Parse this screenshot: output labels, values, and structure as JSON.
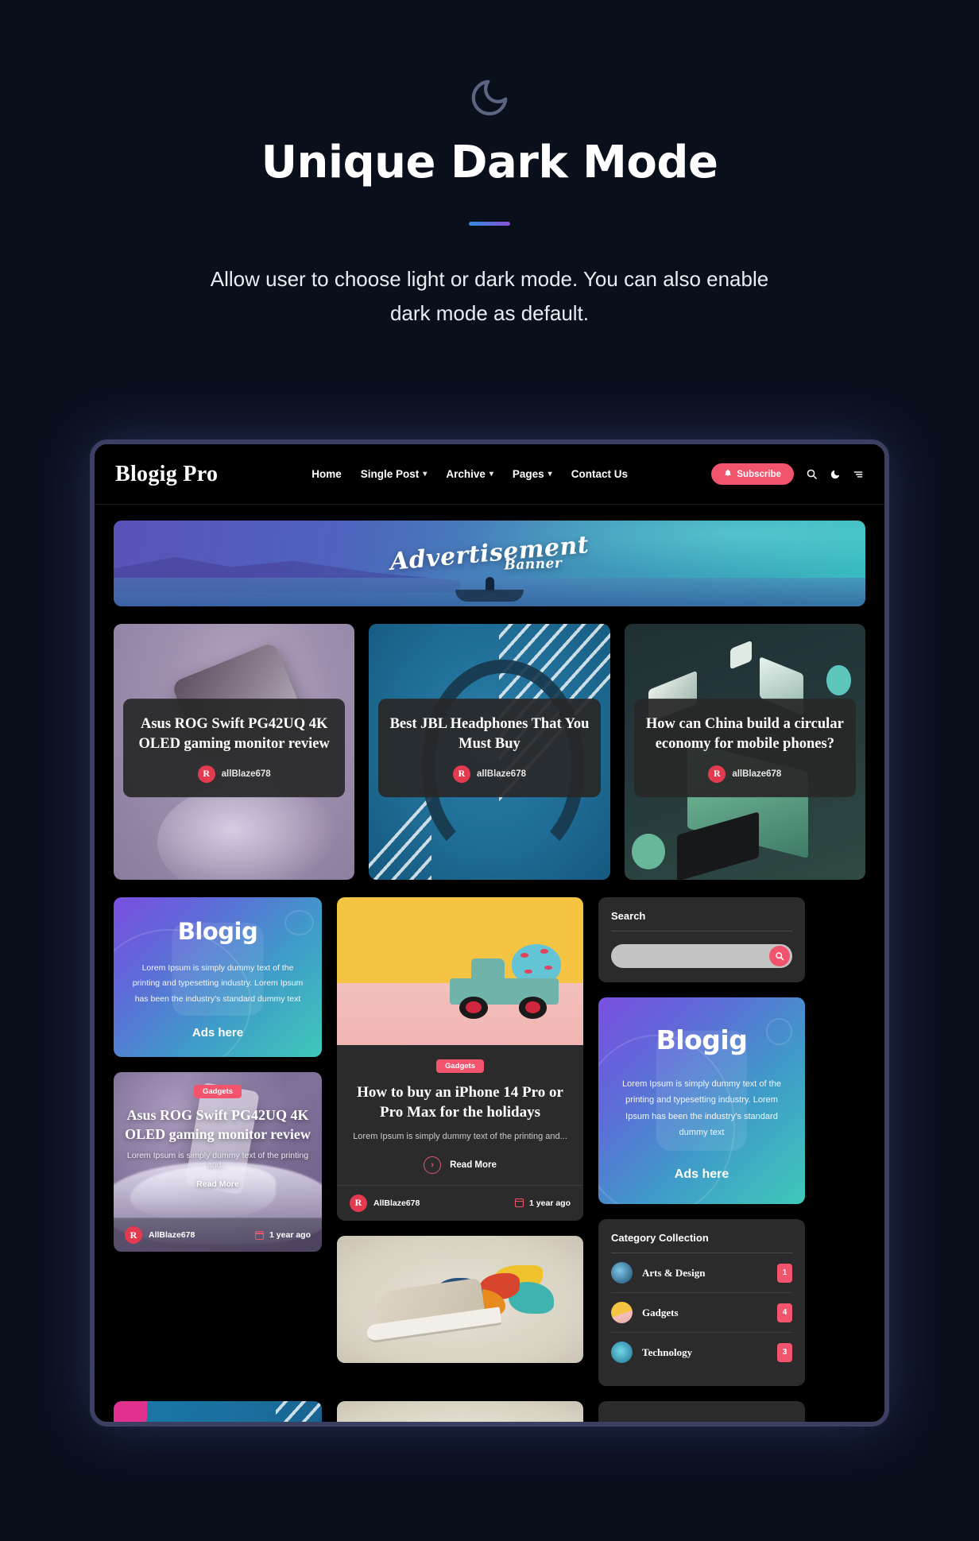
{
  "hero": {
    "icon": "moon-icon",
    "title": "Unique Dark Mode",
    "subtitle": "Allow user to choose light or dark mode. You can also enable dark mode as default.",
    "accent_start": "#2f8fe0",
    "accent_end": "#8a4fd8",
    "background": "#0a0f1c"
  },
  "site": {
    "navbar": {
      "brand": "Blogig Pro",
      "links": [
        {
          "label": "Home",
          "has_dropdown": false
        },
        {
          "label": "Single Post",
          "has_dropdown": true
        },
        {
          "label": "Archive",
          "has_dropdown": true
        },
        {
          "label": "Pages",
          "has_dropdown": true
        },
        {
          "label": "Contact Us",
          "has_dropdown": false
        }
      ],
      "chevron": "⌄",
      "subscribe_label": "Subscribe",
      "subscribe_color": "#f2536d",
      "icons": [
        "bell-icon",
        "search-icon",
        "moon-icon",
        "menu-icon"
      ]
    },
    "ad_banner": {
      "title": "Advertisement",
      "subtitle": "Banner"
    },
    "featured": [
      {
        "title": "Asus ROG Swift PG42UQ 4K OLED gaming monitor review",
        "author": "allBlaze678",
        "avatar_letter": "R",
        "image": "purple-iphone-photo"
      },
      {
        "title": "Best JBL Headphones That You Must Buy",
        "author": "allBlaze678",
        "avatar_letter": "R",
        "image": "blue-headphones-photo"
      },
      {
        "title": "How can China build a circular economy for mobile phones?",
        "author": "allBlaze678",
        "avatar_letter": "R",
        "image": "isometric-tech-illustration"
      }
    ],
    "ad_widget": {
      "brand": "Blogig",
      "text": "Lorem Ipsum is simply dummy text of the printing and typesetting industry. Lorem Ipsum has been the industry's standard dummy text",
      "cta": "Ads here"
    },
    "post_truck": {
      "badge": "Gadgets",
      "title": "How to buy an iPhone 14 Pro or Pro Max for the holidays",
      "excerpt": "Lorem Ipsum is simply dummy text of the printing and...",
      "read_more": "Read More",
      "author": "AllBlaze678",
      "avatar_letter": "R",
      "date": "1 year ago",
      "image": "yellow-pink-toy-truck-photo"
    },
    "post_silk": {
      "badge": "Gadgets",
      "title": "Asus ROG Swift PG42UQ 4K OLED gaming monitor review",
      "excerpt": "Lorem Ipsum is simply dummy text of the printing and...",
      "read_more": "Read More",
      "author": "AllBlaze678",
      "avatar_letter": "R",
      "date": "1 year ago",
      "image": "purple-silk-phone-photo"
    },
    "post_shoe": {
      "image": "colorful-paint-sneaker-photo"
    },
    "search_widget": {
      "title": "Search",
      "value": "",
      "placeholder": "",
      "button_icon": "search-icon"
    },
    "category_widget": {
      "title": "Category Collection",
      "items": [
        {
          "name": "Arts & Design",
          "count": "1",
          "thumb": "arts-thumb"
        },
        {
          "name": "Gadgets",
          "count": "4",
          "thumb": "gadgets-thumb"
        },
        {
          "name": "Technology",
          "count": "3",
          "thumb": "technology-thumb"
        }
      ]
    },
    "frame_border_color": "#3b4063"
  }
}
